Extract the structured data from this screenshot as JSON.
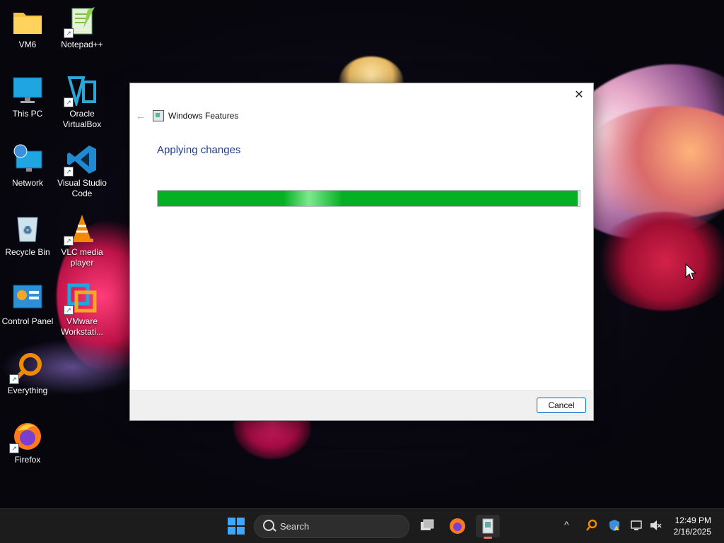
{
  "desktop": {
    "icons": [
      {
        "label": "VM6"
      },
      {
        "label": "Notepad++"
      },
      {
        "label": "This PC"
      },
      {
        "label": "Oracle VirtualBox"
      },
      {
        "label": "Network"
      },
      {
        "label": "Visual Studio Code"
      },
      {
        "label": "Recycle Bin"
      },
      {
        "label": "VLC media player"
      },
      {
        "label": "Control Panel"
      },
      {
        "label": "VMware Workstati..."
      },
      {
        "label": "Everything"
      },
      {
        "label": "Firefox"
      }
    ]
  },
  "dialog": {
    "title": "Windows Features",
    "heading": "Applying changes",
    "progress": 0.995,
    "cancel_label": "Cancel",
    "close_glyph": "✕",
    "back_glyph": "←"
  },
  "taskbar": {
    "search_placeholder": "Search",
    "time": "12:49 PM",
    "date": "2/16/2025",
    "tray_chevron": "^"
  },
  "colors": {
    "progress_green": "#06b025",
    "accent_blue": "#0067c0",
    "heading_blue": "#1e3f8a"
  }
}
